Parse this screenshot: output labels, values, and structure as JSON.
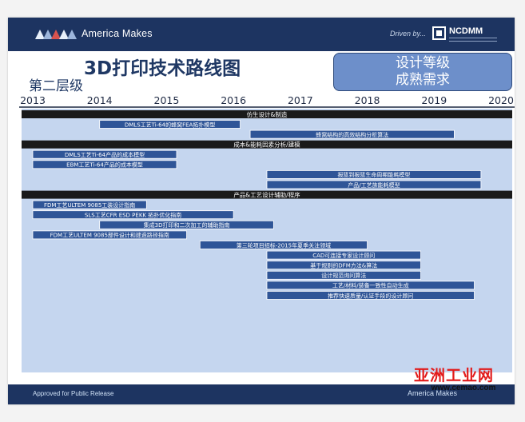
{
  "slide": {
    "brand": "America Makes",
    "driven_by": "Driven by...",
    "partner": "NCDMM",
    "title": "3D打印技术路线图",
    "level": "第二层级",
    "badge_line1": "设计等级",
    "badge_line2": "成熟需求",
    "footer_left": "Approved for Public Release",
    "footer_right": "America Makes"
  },
  "watermark": {
    "text": "亚洲工业网",
    "url": "www.cemao.com"
  },
  "colors": {
    "header": "#1d3461",
    "plot_background": "#c5d6ef",
    "section_bar": "#1a1a1a",
    "task_bar": "#2f5597",
    "badge": "#6d8fca",
    "title_text": "#1f3864"
  },
  "chart_data": {
    "type": "gantt",
    "x_ticks": [
      "2013",
      "2014",
      "2015",
      "2016",
      "2017",
      "2018",
      "2019",
      "2020"
    ],
    "xlim": [
      2013,
      2020
    ],
    "rows": [
      {
        "kind": "section",
        "label": "仿生设计&制造"
      },
      {
        "kind": "task",
        "label": "DMLS工艺Ti-64的蜂窝FEA拓扑模型",
        "start": 2014.0,
        "end": 2016.1
      },
      {
        "kind": "task",
        "label": "蜂窝结构的高效结构分析算法",
        "start": 2016.25,
        "end": 2019.3
      },
      {
        "kind": "section",
        "label": "成本&能耗因素分析/建模"
      },
      {
        "kind": "task",
        "label": "DMLS工艺Ti-64产品的成本模型",
        "start": 2013.0,
        "end": 2015.15
      },
      {
        "kind": "task",
        "label": "EBM工艺Ti-64产品的成本模型",
        "start": 2013.0,
        "end": 2015.15
      },
      {
        "kind": "task",
        "label": "报篮到报篮生命周期能耗模型",
        "start": 2016.5,
        "end": 2019.7
      },
      {
        "kind": "task",
        "label": "产品/工艺族能耗模型",
        "start": 2016.5,
        "end": 2019.7
      },
      {
        "kind": "section",
        "label": "产品&工艺设计辅助/程序"
      },
      {
        "kind": "task",
        "label": "FDM工艺ULTEM 9085工装设计指南",
        "start": 2013.0,
        "end": 2014.7
      },
      {
        "kind": "task",
        "label": "SLS工艺CFR ESD PEKK 拓扑优化指南",
        "start": 2013.0,
        "end": 2016.0
      },
      {
        "kind": "task",
        "label": "集成3D打印和二次加工的辅助指南",
        "start": 2014.0,
        "end": 2016.6
      },
      {
        "kind": "task",
        "label": "FDM工艺ULTEM 9085部件设计和建造路径指南",
        "start": 2013.0,
        "end": 2015.3
      },
      {
        "kind": "task",
        "label": "第三轮项目招标-2015年夏季关注领域",
        "start": 2015.5,
        "end": 2018.0
      },
      {
        "kind": "task",
        "label": "CAD可连接专家设计顾问",
        "start": 2016.5,
        "end": 2018.8
      },
      {
        "kind": "task",
        "label": "基于规则的DFM方法&算法",
        "start": 2016.5,
        "end": 2018.8
      },
      {
        "kind": "task",
        "label": "设计规范询问算法",
        "start": 2016.5,
        "end": 2018.8
      },
      {
        "kind": "task",
        "label": "工艺/材料/装备一致性自动生成",
        "start": 2016.5,
        "end": 2019.6
      },
      {
        "kind": "task",
        "label": "推荐快速质量/认证手段的设计顾问",
        "start": 2016.5,
        "end": 2019.6
      }
    ]
  }
}
